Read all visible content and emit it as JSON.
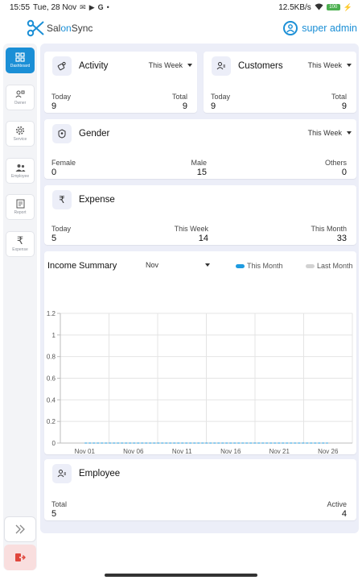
{
  "status_bar": {
    "time": "15:55",
    "date": "Tue, 28 Nov",
    "network_speed": "12.5KB/s",
    "battery": "100"
  },
  "header": {
    "brand_prefix": "Sal",
    "brand_accent": "on",
    "brand_suffix": "Sync",
    "username": "super admin"
  },
  "sidebar": {
    "items": [
      {
        "label": "Dashboard",
        "icon": "dashboard-icon"
      },
      {
        "label": "Owner",
        "icon": "owner-icon"
      },
      {
        "label": "Service",
        "icon": "gear-icon"
      },
      {
        "label": "Employee",
        "icon": "people-icon"
      },
      {
        "label": "Report",
        "icon": "report-icon"
      },
      {
        "label": "Expense",
        "icon": "rupee-icon"
      }
    ]
  },
  "activity": {
    "title": "Activity",
    "period": "This Week",
    "today_label": "Today",
    "today_value": "9",
    "total_label": "Total",
    "total_value": "9"
  },
  "customers": {
    "title": "Customers",
    "period": "This Week",
    "today_label": "Today",
    "today_value": "9",
    "total_label": "Total",
    "total_value": "9"
  },
  "gender": {
    "title": "Gender",
    "period": "This Week",
    "female_label": "Female",
    "female_value": "0",
    "male_label": "Male",
    "male_value": "15",
    "others_label": "Others",
    "others_value": "0"
  },
  "expense": {
    "title": "Expense",
    "today_label": "Today",
    "today_value": "5",
    "week_label": "This Week",
    "week_value": "14",
    "month_label": "This Month",
    "month_value": "33"
  },
  "income": {
    "title": "Income Summary",
    "month": "Nov",
    "legend_this": "This Month",
    "legend_last": "Last Month"
  },
  "employee": {
    "title": "Employee",
    "total_label": "Total",
    "total_value": "5",
    "active_label": "Active",
    "active_value": "4"
  },
  "colors": {
    "accent": "#1b8fd6",
    "this_month": "#1e9be0",
    "last_month": "#d2d2d2",
    "logout_bg": "#f9dede",
    "logout_icon": "#e0463c"
  },
  "chart_data": {
    "type": "line",
    "x": [
      "Nov 01",
      "Nov 06",
      "Nov 11",
      "Nov 16",
      "Nov 21",
      "Nov 26"
    ],
    "ylim": [
      0,
      1.2
    ],
    "yticks": [
      "0",
      "0.2",
      "0.4",
      "0.6",
      "0.8",
      "1",
      "1.2"
    ],
    "series": [
      {
        "name": "This Month",
        "values": [
          0,
          0,
          0,
          0,
          0,
          0
        ]
      },
      {
        "name": "Last Month",
        "values": [
          0,
          0,
          0,
          0,
          0,
          0
        ]
      }
    ],
    "grid": true,
    "legend": "top-right"
  }
}
